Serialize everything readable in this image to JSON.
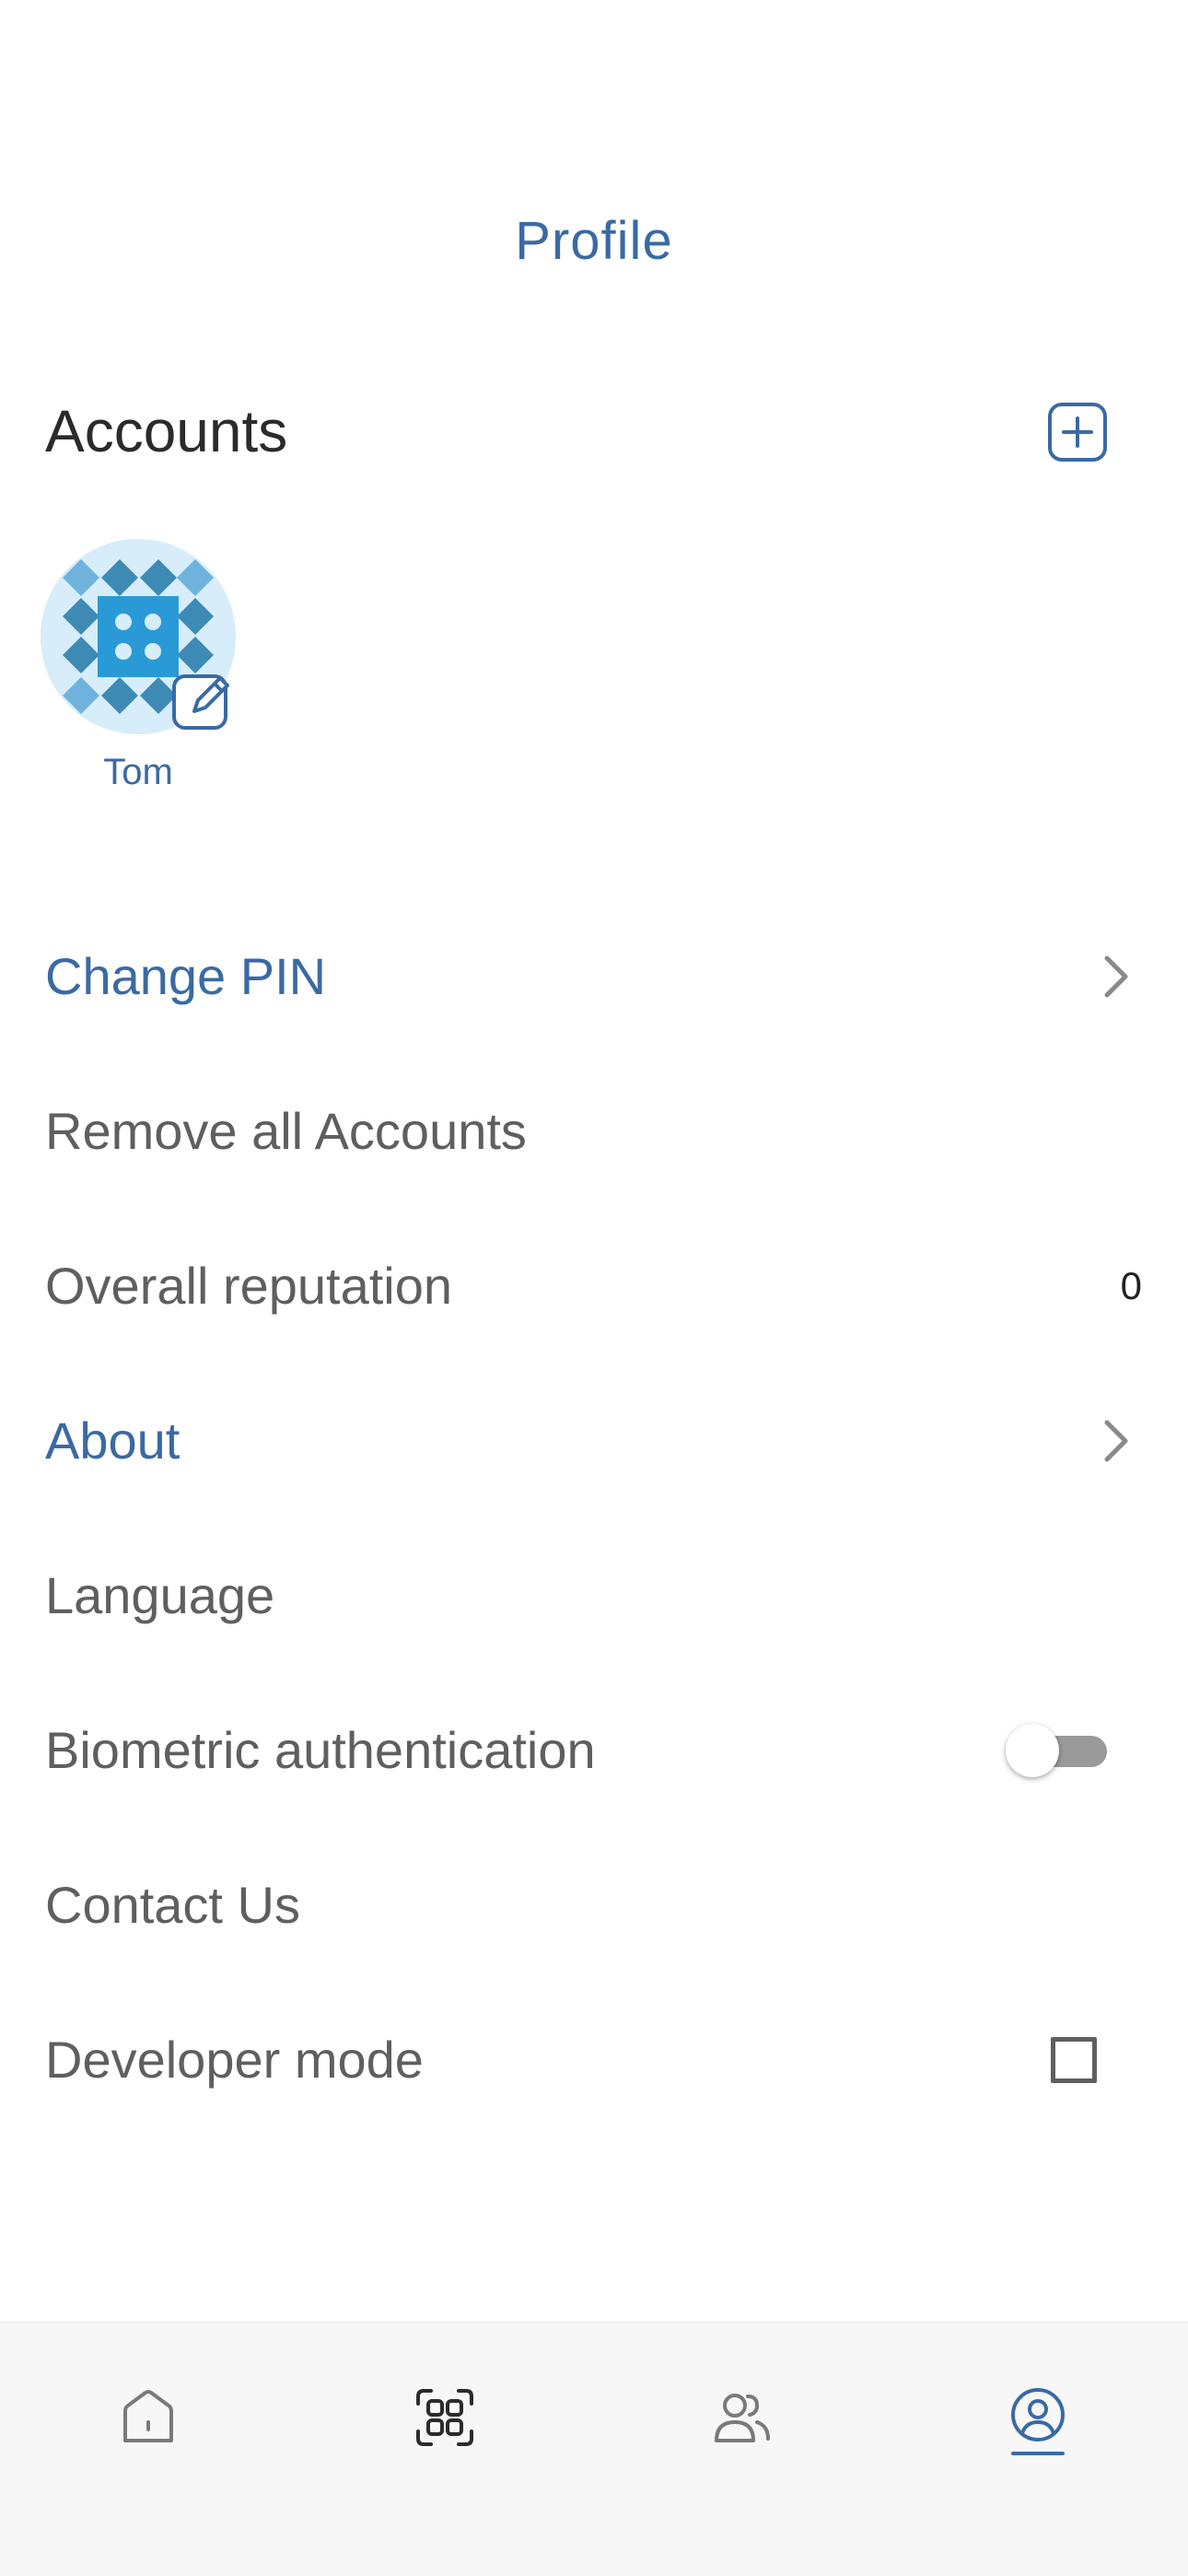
{
  "header": {
    "title": "Profile"
  },
  "accounts": {
    "heading": "Accounts",
    "add_icon": "plus-square-icon",
    "items": [
      {
        "name": "Tom",
        "avatar_icon": "identicon-avatar",
        "edit_icon": "edit-pencil-icon"
      }
    ]
  },
  "menu": {
    "change_pin": {
      "label": "Change PIN",
      "icon": "chevron-right-icon"
    },
    "remove_all": {
      "label": "Remove all Accounts"
    },
    "reputation": {
      "label": "Overall reputation",
      "value": "0"
    },
    "about": {
      "label": "About",
      "icon": "chevron-right-icon"
    },
    "language": {
      "label": "Language"
    },
    "biometric": {
      "label": "Biometric authentication",
      "enabled": false
    },
    "contact": {
      "label": "Contact Us"
    },
    "developer": {
      "label": "Developer mode",
      "checked": false
    }
  },
  "tabbar": {
    "tabs": [
      {
        "id": "home",
        "icon": "home-icon",
        "active": false
      },
      {
        "id": "scan",
        "icon": "qr-scan-icon",
        "active": false
      },
      {
        "id": "contacts",
        "icon": "people-icon",
        "active": false
      },
      {
        "id": "profile",
        "icon": "user-circle-icon",
        "active": true
      }
    ]
  },
  "colors": {
    "accent": "#3a6aa4",
    "text": "#5f5f5f",
    "heading": "#2b2b2b",
    "tabbar_bg": "#f7f7f7",
    "avatar_bg": "#d7edf9"
  }
}
